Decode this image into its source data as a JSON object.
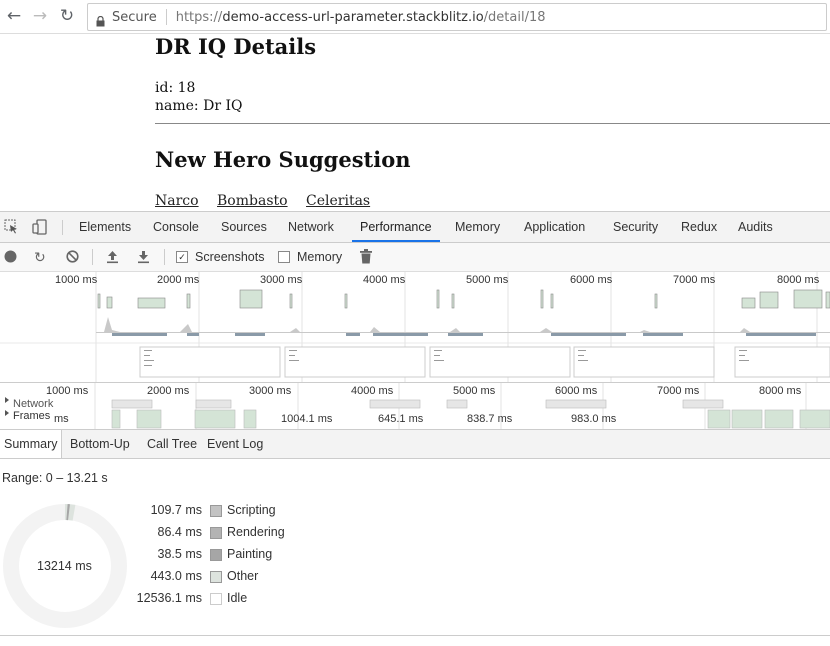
{
  "browser": {
    "secure_label": "Secure",
    "url_scheme": "https://",
    "url_host": "demo-access-url-parameter.stackblitz.io",
    "url_path": "/detail/18"
  },
  "page": {
    "detail_title": "DR IQ Details",
    "id_line": "id: 18",
    "name_line": "name: Dr IQ",
    "suggestion_title": "New Hero Suggestion",
    "links": [
      "Narco",
      "Bombasto",
      "Celeritas"
    ]
  },
  "devtools": {
    "tabs": [
      "Elements",
      "Console",
      "Sources",
      "Network",
      "Performance",
      "Memory",
      "Application",
      "Security",
      "Redux",
      "Audits"
    ],
    "active_tab": "Performance",
    "toolbar": {
      "screenshots_label": "Screenshots",
      "memory_label": "Memory"
    },
    "overview_ticks": [
      "1000 ms",
      "2000 ms",
      "3000 ms",
      "4000 ms",
      "5000 ms",
      "6000 ms",
      "7000 ms",
      "8000 ms"
    ],
    "main_ticks": [
      "1000 ms",
      "2000 ms",
      "3000 ms",
      "4000 ms",
      "5000 ms",
      "6000 ms",
      "7000 ms",
      "8000 ms"
    ],
    "tracks": {
      "network_label": "Network",
      "frames_label": "Frames",
      "frames_prefix": "ms",
      "frame_times": [
        "1004.1 ms",
        "645.1 ms",
        "838.7 ms",
        "983.0 ms"
      ]
    },
    "subtabs": [
      "Summary",
      "Bottom-Up",
      "Call Tree",
      "Event Log"
    ],
    "summary": {
      "range": "Range: 0 – 13.21 s",
      "total": "13214 ms",
      "rows": [
        {
          "value": "109.7 ms",
          "name": "Scripting",
          "color": "#c3c3c3"
        },
        {
          "value": "86.4 ms",
          "name": "Rendering",
          "color": "#b3b3b3"
        },
        {
          "value": "38.5 ms",
          "name": "Painting",
          "color": "#a6a6a6"
        },
        {
          "value": "443.0 ms",
          "name": "Other",
          "color": "#dde3de"
        },
        {
          "value": "12536.1 ms",
          "name": "Idle",
          "color": "#ffffff"
        }
      ]
    }
  },
  "colors": {
    "accent": "#1a73e8",
    "chart_green": "#d4e4d6"
  }
}
